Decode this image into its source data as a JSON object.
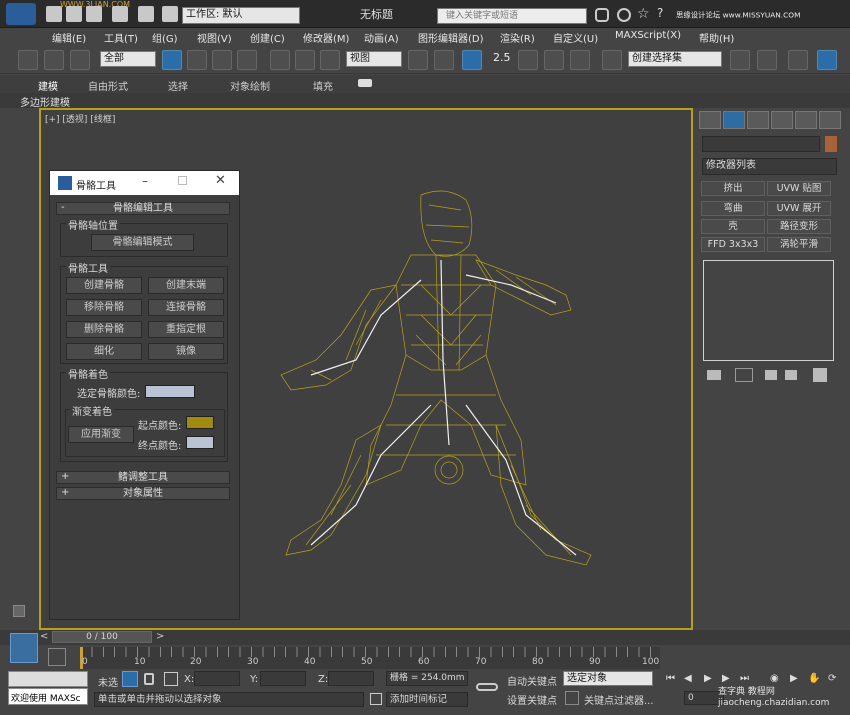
{
  "window": {
    "title": "无标题",
    "workspace_label": "工作区: 默认",
    "search_placeholder": "键入关键字或短语",
    "watermark_top": "思缘设计论坛 www.MISSYUAN.COM",
    "brand": "WWW.3LIAN.COM"
  },
  "menu": [
    "编辑(E)",
    "工具(T)",
    "组(G)",
    "视图(V)",
    "创建(C)",
    "修改器(M)",
    "动画(A)",
    "图形编辑器(D)",
    "渲染(R)",
    "自定义(U)",
    "MAXScript(X)",
    "帮助(H)"
  ],
  "toolbar": {
    "selection_filter": "全部",
    "reference_coord": "视图",
    "numeric": "2.5",
    "named_selection": "创建选择集"
  },
  "ribbon": {
    "tabs": [
      "建模",
      "自由形式",
      "选择",
      "对象绘制",
      "填充"
    ],
    "subtab": "多边形建模"
  },
  "viewport": {
    "label": "[+] [透视] [线框]"
  },
  "command_panel": {
    "modifier_list": "修改器列表",
    "buttons": [
      "挤出",
      "UVW 贴图",
      "弯曲",
      "UVW 展开",
      "壳",
      "路径变形",
      "FFD 3x3x3",
      "涡轮平滑"
    ]
  },
  "dialog": {
    "title": "骨骼工具",
    "rollout_bone_edit": "骨骼编辑工具",
    "group_pivot": "骨骼轴位置",
    "btn_bone_edit_mode": "骨骼编辑模式",
    "group_bone_tools": "骨骼工具",
    "btn_create_bone": "创建骨骼",
    "btn_create_end": "创建末端",
    "btn_remove_bone": "移除骨骼",
    "btn_connect_bone": "连接骨骼",
    "btn_delete_bone": "删除骨骼",
    "btn_reassign_root": "重指定根",
    "btn_refine": "细化",
    "btn_mirror": "镜像",
    "group_bone_color": "骨骼着色",
    "label_selected_color": "选定骨骼颜色:",
    "group_gradient": "渐变着色",
    "btn_apply_gradient": "应用渐变",
    "label_start_color": "起点颜色:",
    "label_end_color": "终点颜色:",
    "rollout_fin": "鳍调整工具",
    "rollout_obj_props": "对象属性",
    "colors": {
      "selected": "#b8c4d4",
      "start": "#a08a10",
      "end": "#b8c4d4"
    }
  },
  "timeline": {
    "frame": "0 / 100",
    "ticks": [
      "0",
      "10",
      "20",
      "30",
      "40",
      "50",
      "60",
      "70",
      "80",
      "90",
      "100"
    ]
  },
  "status": {
    "welcome": "欢迎使用 MAXSc",
    "unselected": "未选",
    "x_label": "X:",
    "y_label": "Y:",
    "z_label": "Z:",
    "grid": "栅格 = 254.0mm",
    "prompt": "单击或单击并拖动以选择对象",
    "add_time_tag": "添加时间标记",
    "auto_key": "自动关键点",
    "set_key": "设置关键点",
    "key_mode_select": "选定对象",
    "key_filters": "关键点过滤器...",
    "frame_field": "0",
    "watermark_bottom": "查字典 教程网 jiaocheng.chazidian.com"
  }
}
